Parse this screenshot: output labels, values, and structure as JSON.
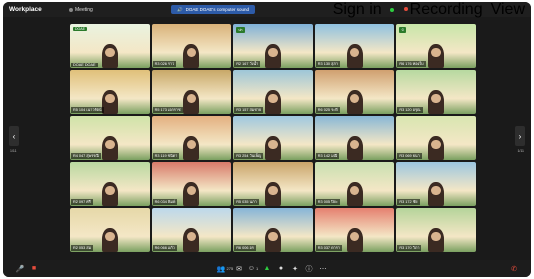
{
  "window": {
    "app_name": "Workplace",
    "meeting_label": "Meeting"
  },
  "sound_chip": {
    "label": "DOAE DOAE's computer sound"
  },
  "top_right": {
    "signin": "Sign in",
    "recording": "Recording",
    "view": "View"
  },
  "pager": {
    "left_label": "1/11",
    "right_label": "1/11"
  },
  "toolbar": {
    "participants_count": "275",
    "reactions_count": "1"
  },
  "colors": {
    "bg": "#1a1a1a",
    "recording": "#e74c3c",
    "secure": "#2ecc40"
  },
  "tiles": [
    {
      "label": "DOAE DOAE",
      "bg": "#e9f3e0",
      "badge": "DOAE"
    },
    {
      "label": "R3 026 ราว",
      "bg": "#d9b27a",
      "badge": ""
    },
    {
      "label": "R2 167 วั่งน้ำ",
      "bg": "#7fb1d8",
      "badge": "ปก"
    },
    {
      "label": "R3 130 สุภา",
      "bg": "#8fc1e0",
      "badge": ""
    },
    {
      "label": "R6 176 ทองใบ",
      "bg": "#c7e6a8",
      "badge": "ป๋"
    },
    {
      "label": "R5 104 เนาวรัตน์",
      "bg": "#e0c07a",
      "badge": ""
    },
    {
      "label": "R5 173 เอกราช",
      "bg": "#c8a868",
      "badge": ""
    },
    {
      "label": "R3 157 สมชาย",
      "bg": "#9ec6d8",
      "badge": ""
    },
    {
      "label": "R6 025 ระพี",
      "bg": "#d0a070",
      "badge": ""
    },
    {
      "label": "R3 120 อรุณ",
      "bg": "#b7d9a0",
      "badge": ""
    },
    {
      "label": "R4 047 สุพรรณี",
      "bg": "#cfe3a8",
      "badge": ""
    },
    {
      "label": "R3 119 ชนิดา",
      "bg": "#e3b080",
      "badge": ""
    },
    {
      "label": "R3 254 วันเพ็ญ",
      "bg": "#9fc8e0",
      "badge": ""
    },
    {
      "label": "R3 142 มณี",
      "bg": "#88b7d6",
      "badge": ""
    },
    {
      "label": "R3 069 ธนา",
      "bg": "#d8e6b0",
      "badge": ""
    },
    {
      "label": "R2 097 ศรี",
      "bg": "#b8d8a0",
      "badge": ""
    },
    {
      "label": "R6 034 พิมพ์",
      "bg": "#d87a6a",
      "badge": ""
    },
    {
      "label": "R5 035 นภา",
      "bg": "#c9a46a",
      "badge": ""
    },
    {
      "label": "R3 005 ปิยะ",
      "bg": "#c8e0b0",
      "badge": ""
    },
    {
      "label": "R3 172 ชัย",
      "bg": "#9cc6e0",
      "badge": ""
    },
    {
      "label": "R2 053 สม",
      "bg": "#e6d8a8",
      "badge": ""
    },
    {
      "label": "R6 066 แก้ว",
      "bg": "#bcd8ec",
      "badge": ""
    },
    {
      "label": "R6 006 อร",
      "bg": "#86b5d8",
      "badge": ""
    },
    {
      "label": "R3 037 ดารา",
      "bg": "#e58070",
      "badge": ""
    },
    {
      "label": "R3 170 วิภา",
      "bg": "#b5d49a",
      "badge": ""
    }
  ]
}
